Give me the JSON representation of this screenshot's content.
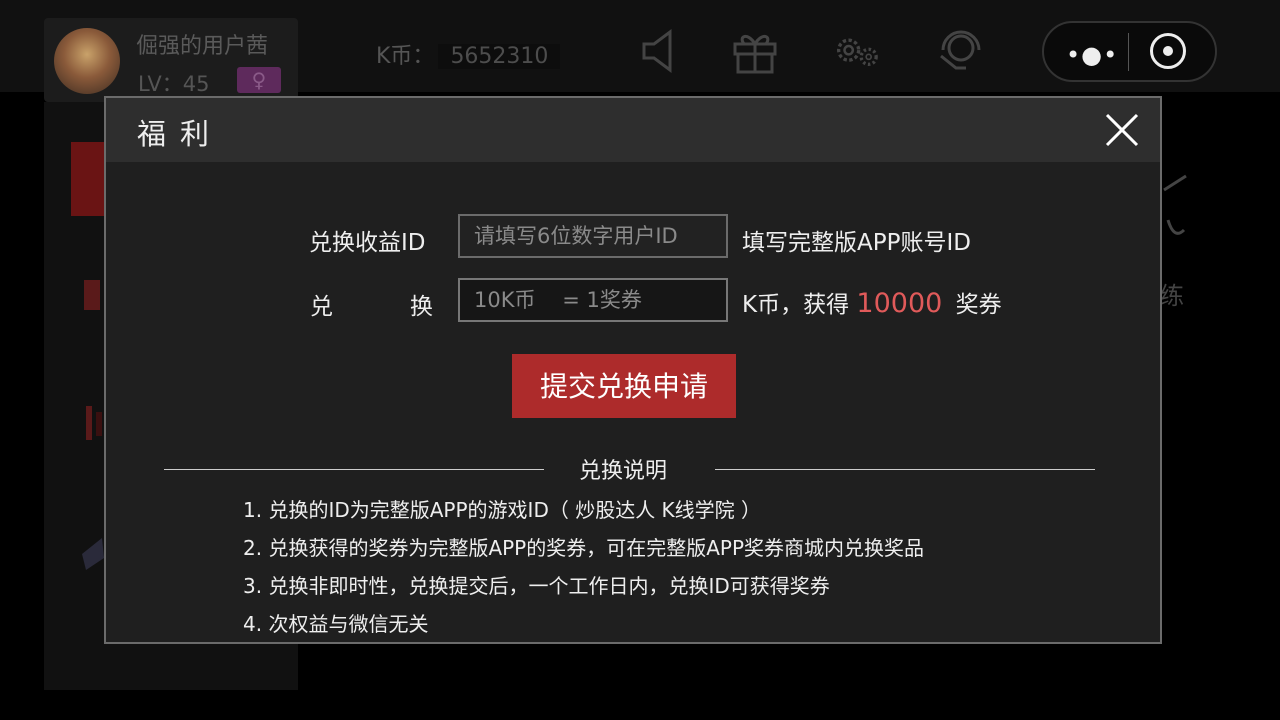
{
  "profile": {
    "username": "倔强的用户茜",
    "level": "LV：45",
    "gender_symbol": "♀"
  },
  "kcoin": {
    "label": "K币：",
    "value": "5652310"
  },
  "topbar_icons": [
    "speaker-icon",
    "gift-icon",
    "gear-icon",
    "headset-icon"
  ],
  "capsule": {
    "more": "•●•"
  },
  "background": {
    "right_label": "练"
  },
  "modal": {
    "title": "福利",
    "close_symbol": "✕",
    "form": {
      "id_label": "兑换收益ID",
      "id_placeholder": "请填写6位数字用户ID",
      "id_hint": "填写完整版APP账号ID",
      "exchange_label_left": "兑",
      "exchange_label_right": "换",
      "exchange_placeholder": "10K币    = 1奖券",
      "exchange_unit": "K币，获得",
      "exchange_amount": "10000",
      "exchange_reward": "奖券"
    },
    "submit_label": "提交兑换申请",
    "notes_title": "兑换说明",
    "notes": [
      "1. 兑换的ID为完整版APP的游戏ID（ 炒股达人  K线学院 ）",
      "2. 兑换获得的奖券为完整版APP的奖券，可在完整版APP奖券商城内兑换奖品",
      "3. 兑换非即时性，兑换提交后，一个工作日内，兑换ID可获得奖券",
      "4. 次权益与微信无关"
    ]
  },
  "colors": {
    "accent": "#ad2b2b",
    "highlight": "#e05a5a",
    "modal_bg": "#1f1f1f"
  }
}
